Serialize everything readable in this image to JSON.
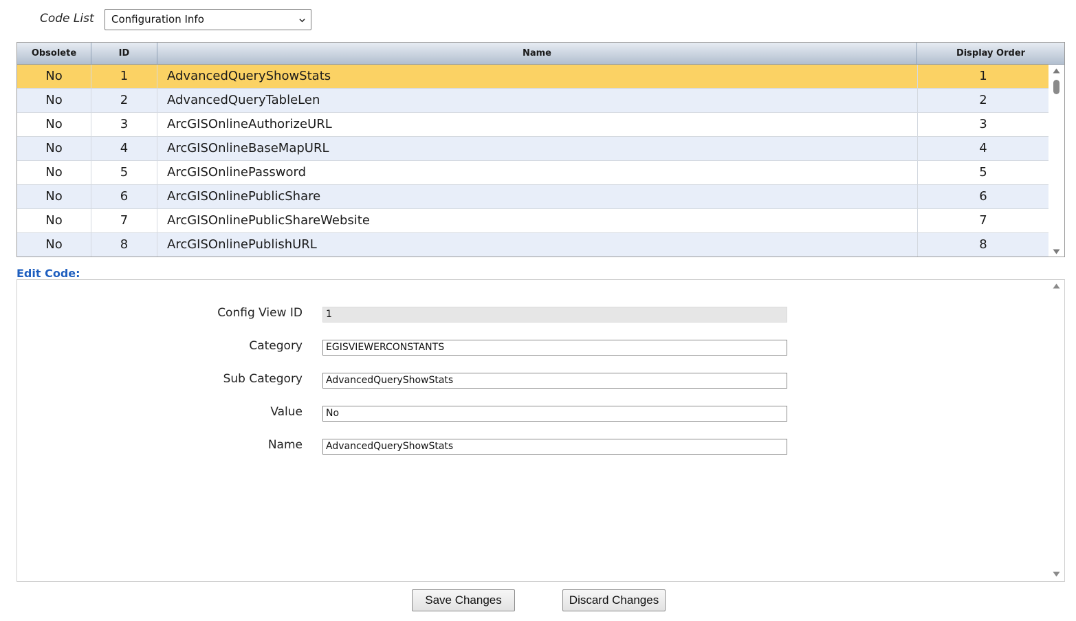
{
  "code_list": {
    "label": "Code List",
    "selected": "Configuration Info"
  },
  "grid": {
    "columns": [
      "Obsolete",
      "ID",
      "Name",
      "Display Order"
    ],
    "rows": [
      {
        "obsolete": "No",
        "id": "1",
        "name": "AdvancedQueryShowStats",
        "order": "1",
        "selected": true
      },
      {
        "obsolete": "No",
        "id": "2",
        "name": "AdvancedQueryTableLen",
        "order": "2"
      },
      {
        "obsolete": "No",
        "id": "3",
        "name": "ArcGISOnlineAuthorizeURL",
        "order": "3"
      },
      {
        "obsolete": "No",
        "id": "4",
        "name": "ArcGISOnlineBaseMapURL",
        "order": "4"
      },
      {
        "obsolete": "No",
        "id": "5",
        "name": "ArcGISOnlinePassword",
        "order": "5"
      },
      {
        "obsolete": "No",
        "id": "6",
        "name": "ArcGISOnlinePublicShare",
        "order": "6"
      },
      {
        "obsolete": "No",
        "id": "7",
        "name": "ArcGISOnlinePublicShareWebsite",
        "order": "7"
      },
      {
        "obsolete": "No",
        "id": "8",
        "name": "ArcGISOnlinePublishURL",
        "order": "8"
      }
    ]
  },
  "edit": {
    "title": "Edit Code:",
    "fields": [
      {
        "label": "Config View ID",
        "value": "1",
        "readonly": true
      },
      {
        "label": "Category",
        "value": "EGISVIEWERCONSTANTS"
      },
      {
        "label": "Sub Category",
        "value": "AdvancedQueryShowStats"
      },
      {
        "label": "Value",
        "value": "No"
      },
      {
        "label": "Name",
        "value": "AdvancedQueryShowStats"
      }
    ]
  },
  "buttons": {
    "save": "Save Changes",
    "discard": "Discard Changes"
  },
  "colors": {
    "selected_row": "#fbd264",
    "alt_row": "#e8eef9",
    "edit_title": "#1f5fbf"
  },
  "icons": [
    "chevron-down-icon",
    "scroll-up-arrow-icon",
    "scroll-down-arrow-icon"
  ]
}
